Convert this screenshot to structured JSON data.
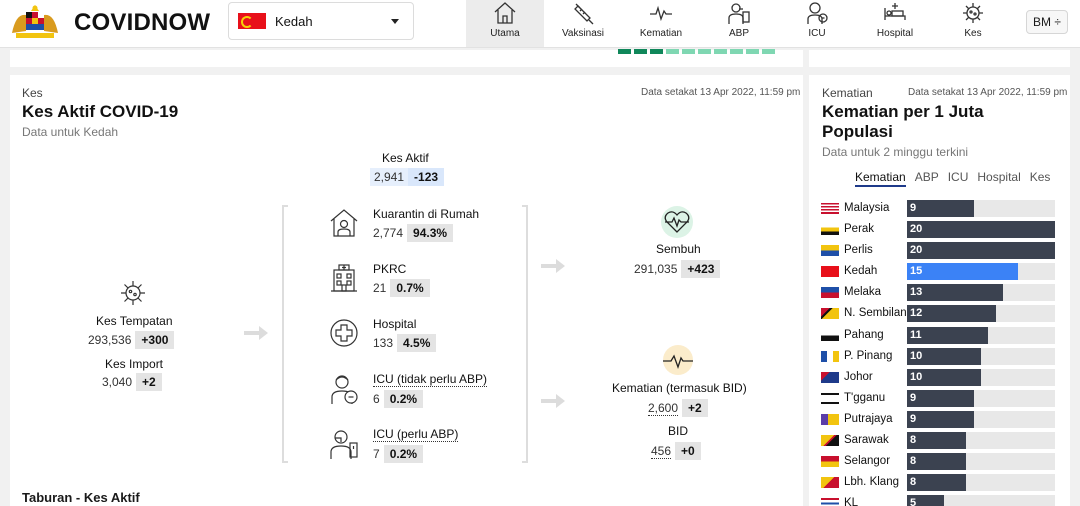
{
  "header": {
    "brand": "COVIDNOW",
    "state": "Kedah",
    "language": "BM ÷",
    "nav": [
      {
        "label": "Utama",
        "icon": "home-icon",
        "active": true
      },
      {
        "label": "Vaksinasi",
        "icon": "syringe-icon",
        "active": false
      },
      {
        "label": "Kematian",
        "icon": "heartbeat-line-icon",
        "active": false
      },
      {
        "label": "ABP",
        "icon": "ventilator-person-icon",
        "active": false
      },
      {
        "label": "ICU",
        "icon": "icu-person-icon",
        "active": false
      },
      {
        "label": "Hospital",
        "icon": "hospital-bed-icon",
        "active": false
      },
      {
        "label": "Kes",
        "icon": "virus-icon",
        "active": false
      }
    ]
  },
  "main": {
    "eyebrow": "Kes",
    "as_of": "Data setakat 13 Apr 2022, 11:59 pm",
    "title": "Kes Aktif COVID-19",
    "subtitle": "Data untuk Kedah",
    "active": {
      "label": "Kes Aktif",
      "value": "2,941",
      "delta": "-123"
    },
    "local": {
      "label": "Kes Tempatan",
      "value": "293,536",
      "delta": "+300"
    },
    "imported": {
      "label": "Kes Import",
      "value": "3,040",
      "delta": "+2"
    },
    "breakdown": [
      {
        "label": "Kuarantin di Rumah",
        "value": "2,774",
        "pct": "94.3%",
        "icon": "home-quarantine-icon",
        "dotted": false
      },
      {
        "label": "PKRC",
        "value": "21",
        "pct": "0.7%",
        "icon": "quarantine-center-icon",
        "dotted": false
      },
      {
        "label": "Hospital",
        "value": "133",
        "pct": "4.5%",
        "icon": "hospital-cross-icon",
        "dotted": false
      },
      {
        "label": "ICU (tidak perlu ABP)",
        "value": "6",
        "pct": "0.2%",
        "icon": "icu-icon",
        "dotted": true
      },
      {
        "label": "ICU (perlu ABP)",
        "value": "7",
        "pct": "0.2%",
        "icon": "ventilator-icon",
        "dotted": true
      }
    ],
    "recovered": {
      "label": "Sembuh",
      "value": "291,035",
      "delta": "+423"
    },
    "deaths": {
      "label": "Kematian (termasuk BID)",
      "value": "2,600",
      "delta": "+2"
    },
    "bid": {
      "label": "BID",
      "value": "456",
      "delta": "+0"
    },
    "next_section": "Taburan - Kes Aktif"
  },
  "side": {
    "eyebrow": "Kematian",
    "as_of": "Data setakat 13 Apr 2022, 11:59 pm",
    "title_line1": "Kematian per 1 Juta",
    "title_line2": "Populasi",
    "subtitle": "Data untuk 2 minggu terkini",
    "tabs": [
      "Kematian",
      "ABP",
      "ICU",
      "Hospital",
      "Kes"
    ],
    "active_tab": 0,
    "max": 20,
    "rows": [
      {
        "name": "Malaysia",
        "value": 9,
        "highlight": false
      },
      {
        "name": "Perak",
        "value": 20,
        "highlight": false
      },
      {
        "name": "Perlis",
        "value": 20,
        "highlight": false
      },
      {
        "name": "Kedah",
        "value": 15,
        "highlight": true
      },
      {
        "name": "Melaka",
        "value": 13,
        "highlight": false
      },
      {
        "name": "N. Sembilan",
        "value": 12,
        "highlight": false
      },
      {
        "name": "Pahang",
        "value": 11,
        "highlight": false
      },
      {
        "name": "P. Pinang",
        "value": 10,
        "highlight": false
      },
      {
        "name": "Johor",
        "value": 10,
        "highlight": false
      },
      {
        "name": "T'gganu",
        "value": 9,
        "highlight": false
      },
      {
        "name": "Putrajaya",
        "value": 9,
        "highlight": false
      },
      {
        "name": "Sarawak",
        "value": 8,
        "highlight": false
      },
      {
        "name": "Selangor",
        "value": 8,
        "highlight": false
      },
      {
        "name": "Lbh. Klang",
        "value": 8,
        "highlight": false
      },
      {
        "name": "KL",
        "value": 5,
        "highlight": false
      }
    ]
  },
  "colors": {
    "bar": "#3b4250",
    "highlight": "#3b82f6",
    "accent_green": "#16a34a"
  }
}
